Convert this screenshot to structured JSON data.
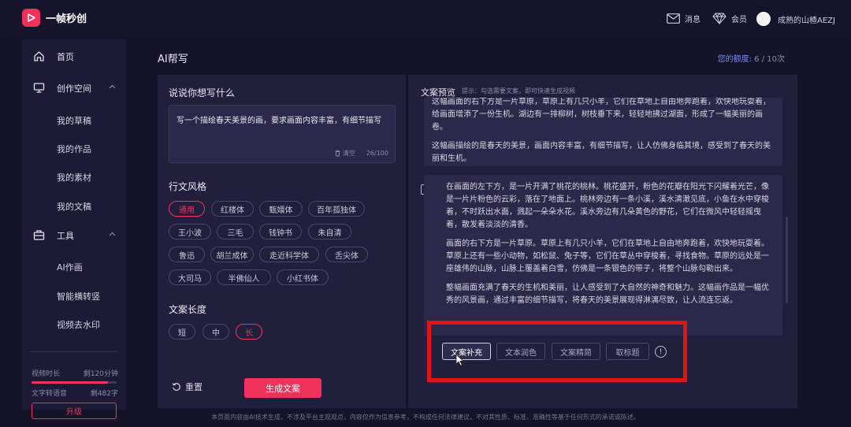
{
  "app": {
    "name": "一帧秒创",
    "brand_color": "#f0325a"
  },
  "topbar": {
    "messages": "消息",
    "member": "会员",
    "username": "成熟的山楂AEZJ"
  },
  "sidebar": {
    "home": "首页",
    "create_space": "创作空间",
    "create_items": [
      "我的草稿",
      "我的作品",
      "我的素材",
      "我的文稿"
    ],
    "tools": "工具",
    "tool_items": [
      "AI作画",
      "智能横转竖",
      "视频去水印"
    ],
    "quota": {
      "video_label": "视频时长",
      "video_value": "剩120分钟",
      "video_fill": 0.9,
      "text_label": "文字转语音",
      "text_value": "剩482字"
    },
    "upgrade": "升级"
  },
  "main": {
    "title": "AI帮写",
    "balance_label": "您的额度:",
    "balance_value": "6 / 10次"
  },
  "left": {
    "prompt_title": "说说你想写什么",
    "prompt_value": "写一个描绘春天美景的画，要求画面内容丰富，有细节描写",
    "clear": "清空",
    "counter": "26/100",
    "style_title": "行文风格",
    "styles": [
      "通用",
      "红楼体",
      "甄嬛体",
      "百年孤独体",
      "王小波",
      "三毛",
      "钱钟书",
      "朱自清",
      "鲁迅",
      "胡兰成体",
      "走近科学体",
      "舌尖体",
      "大司马",
      "半佛仙人",
      "小红书体"
    ],
    "style_selected": "通用",
    "length_title": "文案长度",
    "lengths": [
      "短",
      "中",
      "长"
    ],
    "length_selected": "长",
    "reset": "重置",
    "generate": "生成文案"
  },
  "right": {
    "preview_title": "文案预览",
    "preview_hint": "提示：勾选需要文案，即可快速生成视频",
    "card1": [
      "这幅画面的右下方是一片草原，草原上有几只小羊，它们在草地上自由地奔跑着，欢快地玩耍着，给画面增添了一份生机。湖边有一排柳树，树枝垂下来，轻轻地拂过湖面，形成了一幅美丽的画卷。",
      "这幅画描绘的是春天的美景，画面内容丰富，有细节描写，让人仿佛身临其境，感受到了春天的美丽和生机。"
    ],
    "card2": [
      "在画面的左下方，是一片开满了桃花的桃林。桃花盛开，粉色的花瓣在阳光下闪耀着光芒，像是一片片粉色的云彩，落在了地面上。桃林旁边有一条小溪，溪水清澈见底，小鱼在水中穿梭着，不时跃出水面，溅起一朵朵水花。溪水旁边有几朵黄色的野花，它们在微风中轻轻摇曳着，散发着淡淡的清香。",
      "画面的右下方是一片草原。草原上有几只小羊，它们在草地上自由地奔跑着，欢快地玩耍着。草原上还有一些小动物，如松鼠、兔子等，它们在草丛中穿梭着，寻找食物。草原的远处是一座雄伟的山脉，山脉上覆盖着白雪，仿佛是一条银色的带子，将整个山脉勾勒出来。",
      "整幅画面充满了春天的生机和美丽，让人感受到了大自然的神奇和魅力。这幅画作品是一幅优秀的风景画，通过丰富的细节描写，将春天的美景展现得淋漓尽致，让人流连忘返。"
    ],
    "actions": [
      "文案补充",
      "文本润色",
      "文案精简",
      "取标题"
    ],
    "info": "!"
  },
  "footer": "本页面内容由AI技术生成，不涉及平台主观观点，内容仅作为信息参考，不构成任何法律建议，不对其性质、标准、准确性等基于任何形式的承诺或陈述。"
}
